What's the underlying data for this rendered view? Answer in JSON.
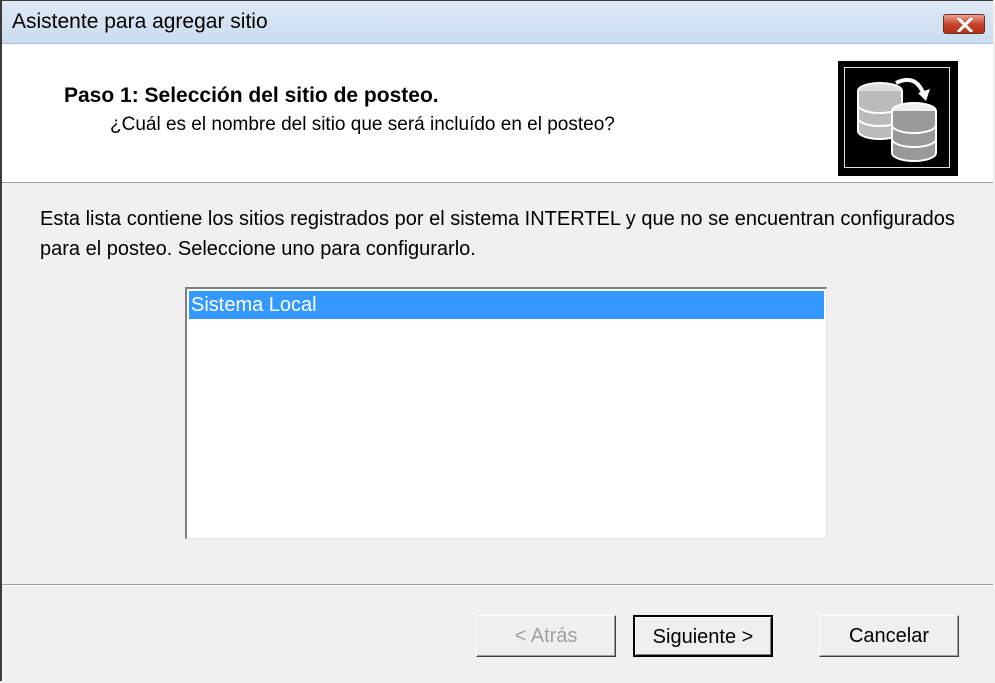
{
  "window": {
    "title": "Asistente para agregar sitio",
    "close_icon": "close-icon"
  },
  "header": {
    "step_title": "Paso 1: Selección del sitio de posteo.",
    "step_subtitle": "¿Cuál es el nombre del sitio que será incluído en el posteo?",
    "icon": "database-sync-icon"
  },
  "body": {
    "description": "Esta lista contiene los sitios registrados por el sistema INTERTEL y que no se encuentran configurados para el posteo. Seleccione uno para configurarlo.",
    "sites": [
      {
        "label": "Sistema Local",
        "selected": true
      }
    ]
  },
  "buttons": {
    "back_label": "< Atrás",
    "next_label": "Siguiente >",
    "cancel_label": "Cancelar"
  },
  "colors": {
    "selection": "#3399ff",
    "titlebar": "#c9dcf0",
    "close": "#c7452b"
  }
}
